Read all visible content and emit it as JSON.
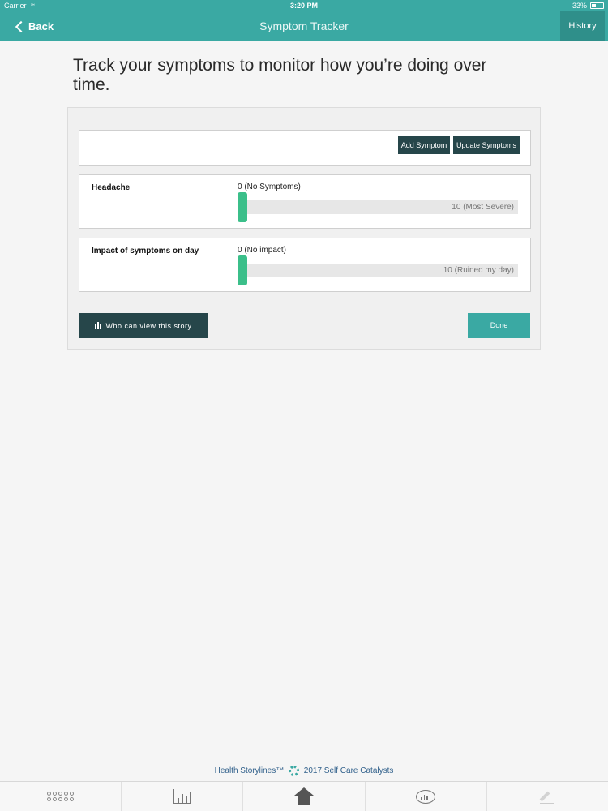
{
  "status_bar": {
    "carrier": "Carrier",
    "time": "3:20 PM",
    "battery": "33%"
  },
  "nav": {
    "back_label": "Back",
    "title": "Symptom Tracker",
    "history_label": "History"
  },
  "intro_text": "Track your symptoms to monitor how you’re doing over time.",
  "toolbar": {
    "add_symptom_label": "Add Symptom",
    "update_symptoms_label": "Update Symptoms"
  },
  "symptoms": [
    {
      "name": "Headache",
      "min_label": "0 (No Symptoms)",
      "max_label": "10 (Most Severe)",
      "value": 0
    },
    {
      "name": "Impact of symptoms on day",
      "min_label": "0 (No impact)",
      "max_label": "10 (Ruined my day)",
      "value": 0
    }
  ],
  "who_can_view_label": "Who can view this story",
  "done_label": "Done",
  "footer": {
    "brand": "Health Storylines™",
    "copyright": "2017 Self Care Catalysts"
  },
  "tabs": [
    {
      "icon": "apps-grid-icon"
    },
    {
      "icon": "chart-icon"
    },
    {
      "icon": "home-icon"
    },
    {
      "icon": "chat-insights-icon"
    },
    {
      "icon": "edit-icon"
    }
  ],
  "colors": {
    "primary_teal": "#3aa9a3",
    "dark_button": "#26464a",
    "slider_thumb": "#3bbf8a"
  }
}
